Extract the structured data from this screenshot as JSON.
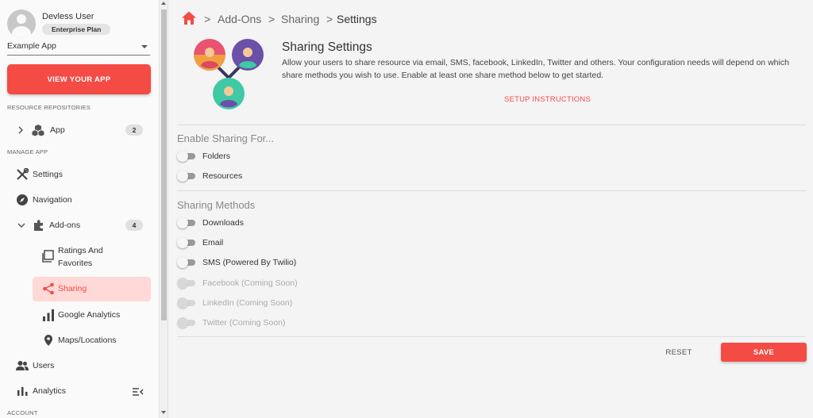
{
  "user": {
    "name": "Devless User",
    "plan": "Enterprise Plan",
    "avatar_icon": "account-circle-icon"
  },
  "app_select": {
    "value": "Example App"
  },
  "view_app_button": "VIEW YOUR APP",
  "sidebar": {
    "section_resource": "RESOURCE REPOSITORIES",
    "app_item": {
      "label": "App",
      "count": "2",
      "icon": "cubes-icon"
    },
    "section_manage": "MANAGE APP",
    "items": [
      {
        "label": "Settings",
        "icon": "tools-icon"
      },
      {
        "label": "Navigation",
        "icon": "compass-icon"
      },
      {
        "label": "Add-ons",
        "count": "4",
        "icon": "puzzle-icon"
      },
      {
        "label": "Ratings And Favorites",
        "line1": "Ratings And",
        "line2": "Favorites",
        "icon": "ratings-icon"
      },
      {
        "label": "Sharing",
        "icon": "share-icon",
        "active": true
      },
      {
        "label": "Google Analytics",
        "icon": "bar-chart-icon"
      },
      {
        "label": "Maps/Locations",
        "icon": "map-pin-icon"
      },
      {
        "label": "Users",
        "icon": "people-icon"
      },
      {
        "label": "Analytics",
        "icon": "analytics-icon"
      }
    ],
    "section_account": "ACCOUNT",
    "collapse_icon": "collapse-menu-icon"
  },
  "breadcrumb": {
    "home_icon": "home-icon",
    "items": [
      "Add-Ons",
      "Sharing",
      "Settings"
    ],
    "separator": ">"
  },
  "header": {
    "title": "Sharing Settings",
    "description": "Allow your users to share resource via email, SMS, facebook, LinkedIn, Twitter and others. Your configuration needs will depend on which share methods you wish to use. Enable at least one share method below to get started.",
    "setup_link": "SETUP INSTRUCTIONS"
  },
  "enable_sharing": {
    "title": "Enable Sharing For...",
    "options": [
      {
        "label": "Folders",
        "enabled": false,
        "disabled": false
      },
      {
        "label": "Resources",
        "enabled": false,
        "disabled": false
      }
    ]
  },
  "sharing_methods": {
    "title": "Sharing Methods",
    "options": [
      {
        "label": "Downloads",
        "enabled": false,
        "disabled": false
      },
      {
        "label": "Email",
        "enabled": false,
        "disabled": false
      },
      {
        "label": "SMS (Powered By Twilio)",
        "enabled": false,
        "disabled": false
      },
      {
        "label": "Facebook (Coming Soon)",
        "enabled": false,
        "disabled": true
      },
      {
        "label": "LinkedIn (Coming Soon)",
        "enabled": false,
        "disabled": true
      },
      {
        "label": "Twitter (Coming Soon)",
        "enabled": false,
        "disabled": true
      }
    ]
  },
  "actions": {
    "reset": "RESET",
    "save": "SAVE"
  },
  "colors": {
    "accent": "#f44b45",
    "active_bg": "#ffd9d7",
    "avatar_pink": "#e8536f",
    "avatar_purple": "#6b4fa8",
    "avatar_teal": "#3fc9a4"
  }
}
